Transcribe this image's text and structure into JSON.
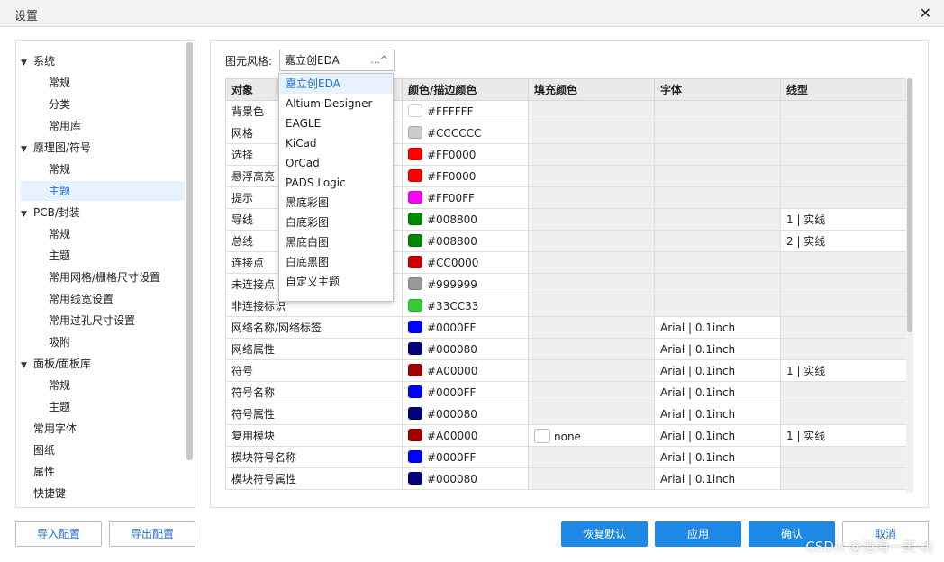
{
  "window": {
    "title": "设置",
    "close": "✕"
  },
  "tree": [
    {
      "label": "系统",
      "level": 0,
      "expanded": true
    },
    {
      "label": "常规",
      "level": 1
    },
    {
      "label": "分类",
      "level": 1
    },
    {
      "label": "常用库",
      "level": 1
    },
    {
      "label": "原理图/符号",
      "level": 0,
      "expanded": true
    },
    {
      "label": "常规",
      "level": 1
    },
    {
      "label": "主题",
      "level": 1,
      "selected": true
    },
    {
      "label": "PCB/封装",
      "level": 0,
      "expanded": true
    },
    {
      "label": "常规",
      "level": 1
    },
    {
      "label": "主题",
      "level": 1
    },
    {
      "label": "常用网格/栅格尺寸设置",
      "level": 1
    },
    {
      "label": "常用线宽设置",
      "level": 1
    },
    {
      "label": "常用过孔尺寸设置",
      "level": 1
    },
    {
      "label": "吸附",
      "level": 1
    },
    {
      "label": "面板/面板库",
      "level": 0,
      "expanded": true
    },
    {
      "label": "常规",
      "level": 1
    },
    {
      "label": "主题",
      "level": 1
    },
    {
      "label": "常用字体",
      "level": 0
    },
    {
      "label": "图纸",
      "level": 0
    },
    {
      "label": "属性",
      "level": 0
    },
    {
      "label": "快捷键",
      "level": 0
    }
  ],
  "style": {
    "label": "图元风格:",
    "value": "嘉立创EDA",
    "ellipsis": "...",
    "caret": "^"
  },
  "dropdown": [
    "嘉立创EDA",
    "Altium Designer",
    "EAGLE",
    "KiCad",
    "OrCad",
    "PADS Logic",
    "黑底彩图",
    "白底彩图",
    "黑底白图",
    "白底黑图",
    "自定义主题"
  ],
  "table": {
    "headers": [
      "对象",
      "颜色/描边颜色",
      "填充颜色",
      "字体",
      "线型"
    ],
    "rows": [
      {
        "object": "背景色",
        "color": "#FFFFFF",
        "swatch": "#FFFFFF",
        "fill": null,
        "font": null,
        "line": null
      },
      {
        "object": "网格",
        "color": "#CCCCCC",
        "swatch": "#CCCCCC",
        "fill": null,
        "font": null,
        "line": null
      },
      {
        "object": "选择",
        "color": "#FF0000",
        "swatch": "#FF0000",
        "fill": null,
        "font": null,
        "line": null
      },
      {
        "object": "悬浮高亮",
        "color": "#FF0000",
        "swatch": "#FF0000",
        "fill": null,
        "font": null,
        "line": null
      },
      {
        "object": "提示",
        "color": "#FF00FF",
        "swatch": "#FF00FF",
        "fill": null,
        "font": null,
        "line": null
      },
      {
        "object": "导线",
        "color": "#008800",
        "swatch": "#008800",
        "fill": null,
        "font": null,
        "line": "1 | 实线"
      },
      {
        "object": "总线",
        "color": "#008800",
        "swatch": "#008800",
        "fill": null,
        "font": null,
        "line": "2 | 实线"
      },
      {
        "object": "连接点",
        "color": "#CC0000",
        "swatch": "#CC0000",
        "fill": null,
        "font": null,
        "line": null
      },
      {
        "object": "未连接点",
        "color": "#999999",
        "swatch": "#999999",
        "fill": null,
        "font": null,
        "line": null
      },
      {
        "object": "非连接标识",
        "color": "#33CC33",
        "swatch": "#33CC33",
        "fill": null,
        "font": null,
        "line": null
      },
      {
        "object": "网络名称/网络标签",
        "color": "#0000FF",
        "swatch": "#0000FF",
        "fill": null,
        "font": "Arial | 0.1inch",
        "line": null
      },
      {
        "object": "网络属性",
        "color": "#000080",
        "swatch": "#000080",
        "fill": null,
        "font": "Arial | 0.1inch",
        "line": null
      },
      {
        "object": "符号",
        "color": "#A00000",
        "swatch": "#A00000",
        "fill": null,
        "font": "Arial | 0.1inch",
        "line": "1 | 实线"
      },
      {
        "object": "符号名称",
        "color": "#0000FF",
        "swatch": "#0000FF",
        "fill": null,
        "font": "Arial | 0.1inch",
        "line": null
      },
      {
        "object": "符号属性",
        "color": "#000080",
        "swatch": "#000080",
        "fill": null,
        "font": "Arial | 0.1inch",
        "line": null
      },
      {
        "object": "复用模块",
        "color": "#A00000",
        "swatch": "#A00000",
        "fill": "none",
        "font": "Arial | 0.1inch",
        "line": "1 | 实线"
      },
      {
        "object": "模块符号名称",
        "color": "#0000FF",
        "swatch": "#0000FF",
        "fill": null,
        "font": "Arial | 0.1inch",
        "line": null
      },
      {
        "object": "模块符号属性",
        "color": "#000080",
        "swatch": "#000080",
        "fill": null,
        "font": "Arial | 0.1inch",
        "line": null
      }
    ]
  },
  "buttons": {
    "import": "导入配置",
    "export": "导出配置",
    "restore": "恢复默认",
    "apply": "应用",
    "ok": "确认",
    "cancel": "取消"
  },
  "watermark": "CSDN @沧海一笑-dj"
}
